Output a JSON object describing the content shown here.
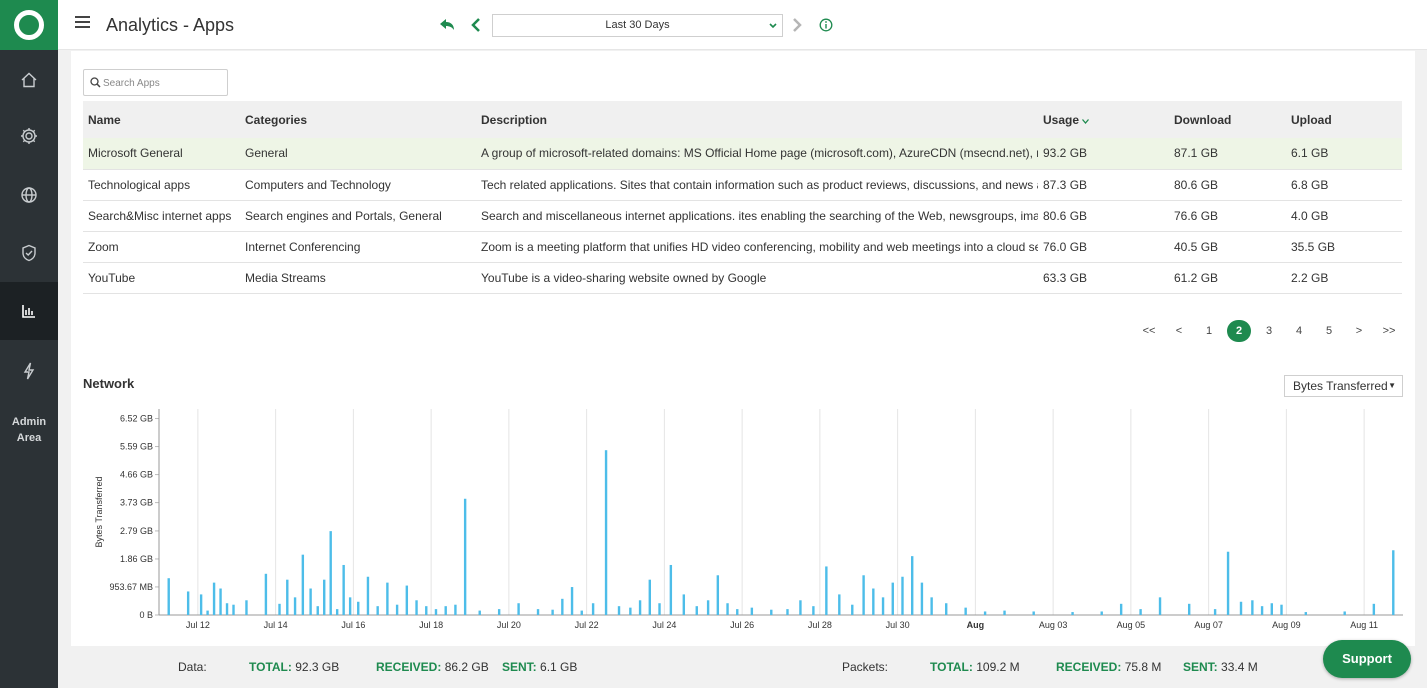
{
  "header": {
    "title": "Analytics - Apps",
    "date_range": "Last 30 Days"
  },
  "sidebar": {
    "items": [
      {
        "name": "home-icon"
      },
      {
        "name": "settings-icon"
      },
      {
        "name": "globe-icon"
      },
      {
        "name": "shield-icon"
      },
      {
        "name": "analytics-icon",
        "active": true
      },
      {
        "name": "lightning-icon"
      }
    ],
    "admin_label_1": "Admin",
    "admin_label_2": "Area"
  },
  "search": {
    "placeholder": "Search Apps",
    "value": ""
  },
  "table": {
    "columns": [
      "Name",
      "Categories",
      "Description",
      "Usage",
      "Download",
      "Upload"
    ],
    "rows": [
      [
        "Microsoft General",
        "General",
        "A group of microsoft-related domains: MS Official Home page (microsoft.com), AzureCDN (msecnd.net), msft",
        "93.2 GB",
        "87.1 GB",
        "6.1 GB"
      ],
      [
        "Technological apps",
        "Computers and Technology",
        "Tech related applications. Sites that contain information such as product reviews, discussions, and news abo",
        "87.3 GB",
        "80.6 GB",
        "6.8 GB"
      ],
      [
        "Search&Misc internet apps",
        "Search engines and Portals, General",
        "Search and miscellaneous internet applications. ites enabling the searching of the Web, newsgroups, images,",
        "80.6 GB",
        "76.6 GB",
        "4.0 GB"
      ],
      [
        "Zoom",
        "Internet Conferencing",
        "Zoom is a meeting platform that unifies HD video conferencing, mobility and web meetings into a cloud servic",
        "76.0 GB",
        "40.5 GB",
        "35.5 GB"
      ],
      [
        "YouTube",
        "Media Streams",
        "YouTube is a video-sharing website owned by Google",
        "63.3 GB",
        "61.2 GB",
        "2.2 GB"
      ]
    ]
  },
  "pagination": {
    "items": [
      "<<",
      "<",
      "1",
      "2",
      "3",
      "4",
      "5",
      ">",
      ">>"
    ],
    "current": "2"
  },
  "network": {
    "title": "Network",
    "metric": "Bytes Transferred"
  },
  "chart_data": {
    "type": "bar",
    "ylabel": "Bytes Transferred",
    "y_ticks": [
      "0 B",
      "953.67 MB",
      "1.86 GB",
      "2.79 GB",
      "3.73 GB",
      "4.66 GB",
      "5.59 GB",
      "6.52 GB"
    ],
    "ylim": [
      0,
      7000
    ],
    "y_unit": "MB",
    "x_ticks": [
      "Jul 12",
      "Jul 14",
      "Jul 16",
      "Jul 18",
      "Jul 20",
      "Jul 22",
      "Jul 24",
      "Jul 26",
      "Jul 28",
      "Jul 30",
      "Aug",
      "Aug 03",
      "Aug 05",
      "Aug 07",
      "Aug 09",
      "Aug 11"
    ],
    "bold_tick": "Aug",
    "x_start": "Jul 11",
    "x_end": "Aug 12",
    "series": [
      {
        "values": [
          [
            "Jul 11",
            1250
          ],
          [
            "Jul 11",
            800
          ],
          [
            "Jul 12",
            700
          ],
          [
            "Jul 12",
            150
          ],
          [
            "Jul 12",
            1100
          ],
          [
            "Jul 12",
            900
          ],
          [
            "Jul 12",
            400
          ],
          [
            "Jul 12",
            350
          ],
          [
            "Jul 13",
            500
          ],
          [
            "Jul 13",
            1400
          ],
          [
            "Jul 14",
            380
          ],
          [
            "Jul 14",
            1200
          ],
          [
            "Jul 14",
            600
          ],
          [
            "Jul 14",
            2050
          ],
          [
            "Jul 14",
            900
          ],
          [
            "Jul 15",
            300
          ],
          [
            "Jul 15",
            1200
          ],
          [
            "Jul 15",
            2850
          ],
          [
            "Jul 15",
            200
          ],
          [
            "Jul 15",
            1700
          ],
          [
            "Jul 15",
            600
          ],
          [
            "Jul 16",
            450
          ],
          [
            "Jul 16",
            1300
          ],
          [
            "Jul 16",
            300
          ],
          [
            "Jul 16",
            1100
          ],
          [
            "Jul 17",
            350
          ],
          [
            "Jul 17",
            1000
          ],
          [
            "Jul 17",
            500
          ],
          [
            "Jul 17",
            300
          ],
          [
            "Jul 18",
            200
          ],
          [
            "Jul 18",
            300
          ],
          [
            "Jul 18",
            350
          ],
          [
            "Jul 18",
            3950
          ],
          [
            "Jul 19",
            150
          ],
          [
            "Jul 19",
            200
          ],
          [
            "Jul 20",
            400
          ],
          [
            "Jul 20",
            200
          ],
          [
            "Jul 21",
            180
          ],
          [
            "Jul 21",
            550
          ],
          [
            "Jul 21",
            950
          ],
          [
            "Jul 21",
            150
          ],
          [
            "Jul 22",
            400
          ],
          [
            "Jul 22",
            5600
          ],
          [
            "Jul 22",
            300
          ],
          [
            "Jul 23",
            250
          ],
          [
            "Jul 23",
            500
          ],
          [
            "Jul 23",
            1200
          ],
          [
            "Jul 23",
            400
          ],
          [
            "Jul 24",
            1700
          ],
          [
            "Jul 24",
            700
          ],
          [
            "Jul 24",
            300
          ],
          [
            "Jul 25",
            500
          ],
          [
            "Jul 25",
            1350
          ],
          [
            "Jul 25",
            400
          ],
          [
            "Jul 25",
            200
          ],
          [
            "Jul 26",
            250
          ],
          [
            "Jul 26",
            180
          ],
          [
            "Jul 27",
            200
          ],
          [
            "Jul 27",
            500
          ],
          [
            "Jul 27",
            300
          ],
          [
            "Jul 28",
            1650
          ],
          [
            "Jul 28",
            700
          ],
          [
            "Jul 28",
            350
          ],
          [
            "Jul 29",
            1350
          ],
          [
            "Jul 29",
            900
          ],
          [
            "Jul 29",
            600
          ],
          [
            "Jul 29",
            1100
          ],
          [
            "Jul 30",
            1300
          ],
          [
            "Jul 30",
            2000
          ],
          [
            "Jul 30",
            1100
          ],
          [
            "Jul 30",
            600
          ],
          [
            "Jul 31",
            400
          ],
          [
            "Jul 31",
            250
          ],
          [
            "Aug 01",
            120
          ],
          [
            "Aug 01",
            150
          ],
          [
            "Aug 02",
            120
          ],
          [
            "Aug 03",
            100
          ],
          [
            "Aug 04",
            120
          ],
          [
            "Aug 04",
            380
          ],
          [
            "Aug 05",
            200
          ],
          [
            "Aug 05",
            600
          ],
          [
            "Aug 06",
            380
          ],
          [
            "Aug 07",
            200
          ],
          [
            "Aug 07",
            2150
          ],
          [
            "Aug 07",
            450
          ],
          [
            "Aug 08",
            500
          ],
          [
            "Aug 08",
            300
          ],
          [
            "Aug 08",
            400
          ],
          [
            "Aug 08",
            350
          ],
          [
            "Aug 09",
            100
          ],
          [
            "Aug 10",
            120
          ],
          [
            "Aug 11",
            380
          ],
          [
            "Aug 11",
            2200
          ]
        ]
      }
    ]
  },
  "footer": {
    "data_label": "Data:",
    "data_total_key": "TOTAL:",
    "data_total": "92.3 GB",
    "data_received_key": "RECEIVED:",
    "data_received": "86.2 GB",
    "data_sent_key": "SENT:",
    "data_sent": "6.1 GB",
    "packets_label": "Packets:",
    "packets_total_key": "TOTAL:",
    "packets_total": "109.2 M",
    "packets_received_key": "RECEIVED:",
    "packets_received": "75.8 M",
    "packets_sent_key": "SENT:",
    "packets_sent": "33.4 M"
  },
  "support_label": "Support",
  "colors": {
    "brand": "#1e8a4f",
    "bar": "#4dbde9",
    "sidebar": "#2c3236"
  }
}
